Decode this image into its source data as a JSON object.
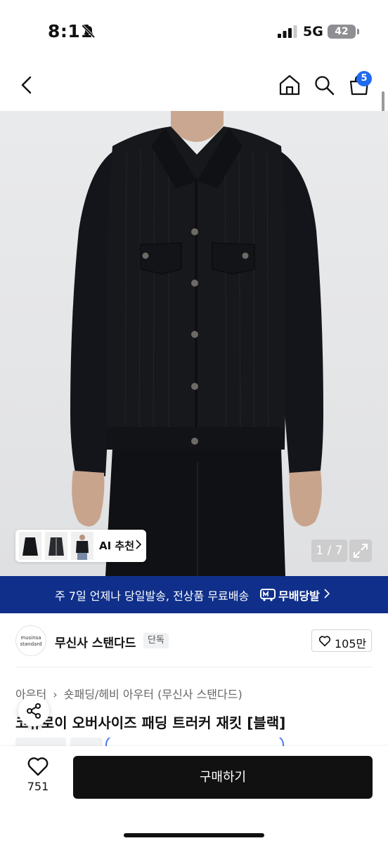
{
  "status_bar": {
    "time": "8:11",
    "network": "5G",
    "battery": "42",
    "icons": [
      "bell-slash-icon",
      "signal-icon"
    ]
  },
  "nav": {
    "icons": [
      "back-icon",
      "home-icon",
      "search-icon",
      "cart-icon"
    ],
    "cart_badge": "5"
  },
  "hero": {
    "image": "product-photo-black-corduroy-trucker-jacket",
    "ai_recommend_label": "AI 추천",
    "page_counter": "1 / 7",
    "thumbnails": [
      "thumb-jacket-front",
      "thumb-jacket-zip",
      "thumb-model"
    ]
  },
  "banner": {
    "text": "주 7일 언제나 당일발송, 전상품 무료배송",
    "logo_text": "무배당발",
    "color": "#0f2f8a"
  },
  "brand": {
    "logo_text_1": "musinsa",
    "logo_text_2": "standard",
    "name": "무신사 스탠다드",
    "tag": "단독",
    "likes": "105만"
  },
  "product": {
    "breadcrumb_category": "아우터",
    "breadcrumb_sub": "숏패딩/헤비 아우터 (무신사 스탠다드)",
    "title": "코듀로이 오버사이즈 패딩 트러커 재킷 [블랙]"
  },
  "bottom_bar": {
    "like_count": "751",
    "buy_label": "구매하기"
  },
  "colors": {
    "accent_blue": "#1f6bf0",
    "buy_button": "#111111"
  }
}
